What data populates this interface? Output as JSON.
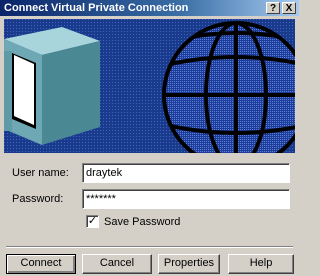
{
  "window": {
    "title": "Connect Virtual Private Connection",
    "help_glyph": "?",
    "close_glyph": "X"
  },
  "banner": {
    "icons": [
      "computer-monitor-icon",
      "globe-icon"
    ],
    "colors": {
      "sky": "#1a3a8c",
      "globe": "#1e3c9a",
      "monitor": "#6ea8b4"
    }
  },
  "form": {
    "username_label": "User name:",
    "username_value": "draytek",
    "password_label": "Password:",
    "password_value": "*******",
    "save_password_label": "Save Password",
    "save_password_checked": "✓"
  },
  "buttons": {
    "connect": "Connect",
    "cancel": "Cancel",
    "properties": "Properties",
    "help": "Help"
  }
}
